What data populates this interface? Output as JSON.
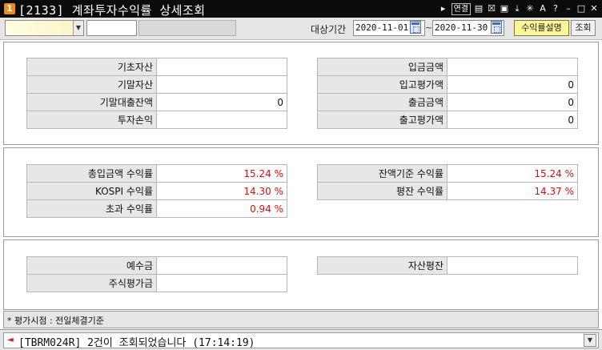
{
  "window": {
    "badge": "1",
    "title": "[2133] 계좌투자수익률 상세조회",
    "tools": {
      "link_label": "연결",
      "icons": [
        "pointer-icon",
        "mouse-icon",
        "checkbox-icon",
        "window-icon",
        "pin-icon",
        "tools-icon",
        "font-icon",
        "help-icon",
        "minimize-icon",
        "maximize-icon",
        "close-icon"
      ],
      "font_glyph": "A",
      "help_glyph": "?"
    }
  },
  "toolbar": {
    "period_label": "대상기간",
    "start_date": "2020-11-01",
    "tilde": "~",
    "end_date": "2020-11-30",
    "desc_button": "수익률설명",
    "query_button": "조회"
  },
  "section1": {
    "left": [
      {
        "label": "기초자산",
        "value": ""
      },
      {
        "label": "기말자산",
        "value": ""
      },
      {
        "label": "기말대출잔액",
        "value": "0"
      },
      {
        "label": "투자손익",
        "value": ""
      }
    ],
    "right": [
      {
        "label": "입금금액",
        "value": ""
      },
      {
        "label": "입고평가액",
        "value": "0"
      },
      {
        "label": "출금금액",
        "value": "0"
      },
      {
        "label": "출고평가액",
        "value": "0"
      }
    ]
  },
  "section2": {
    "left": [
      {
        "label": "총입금액 수익률",
        "value": "15.24 %"
      },
      {
        "label": "KOSPI 수익률",
        "value": "14.30 %"
      },
      {
        "label": "초과 수익률",
        "value": "0.94 %"
      }
    ],
    "right": [
      {
        "label": "잔액기준 수익률",
        "value": "15.24 %"
      },
      {
        "label": "평잔 수익률",
        "value": "14.37 %"
      }
    ],
    "value_color": "#d01010"
  },
  "section3": {
    "left": [
      {
        "label": "예수금",
        "value": ""
      },
      {
        "label": "주식평가금",
        "value": ""
      }
    ],
    "right": [
      {
        "label": "자산평잔",
        "value": ""
      }
    ]
  },
  "footer": {
    "note": "* 평가시점 : 전일체결기준"
  },
  "status": {
    "message": "[TBRM024R] 2건이 조회되었습니다 (17:14:19)"
  },
  "colors": {
    "titlebar": "#0b0b0b",
    "badge": "#f08a1c",
    "desc_button": "#fff59a",
    "label_cell": "#e7e7e7"
  }
}
